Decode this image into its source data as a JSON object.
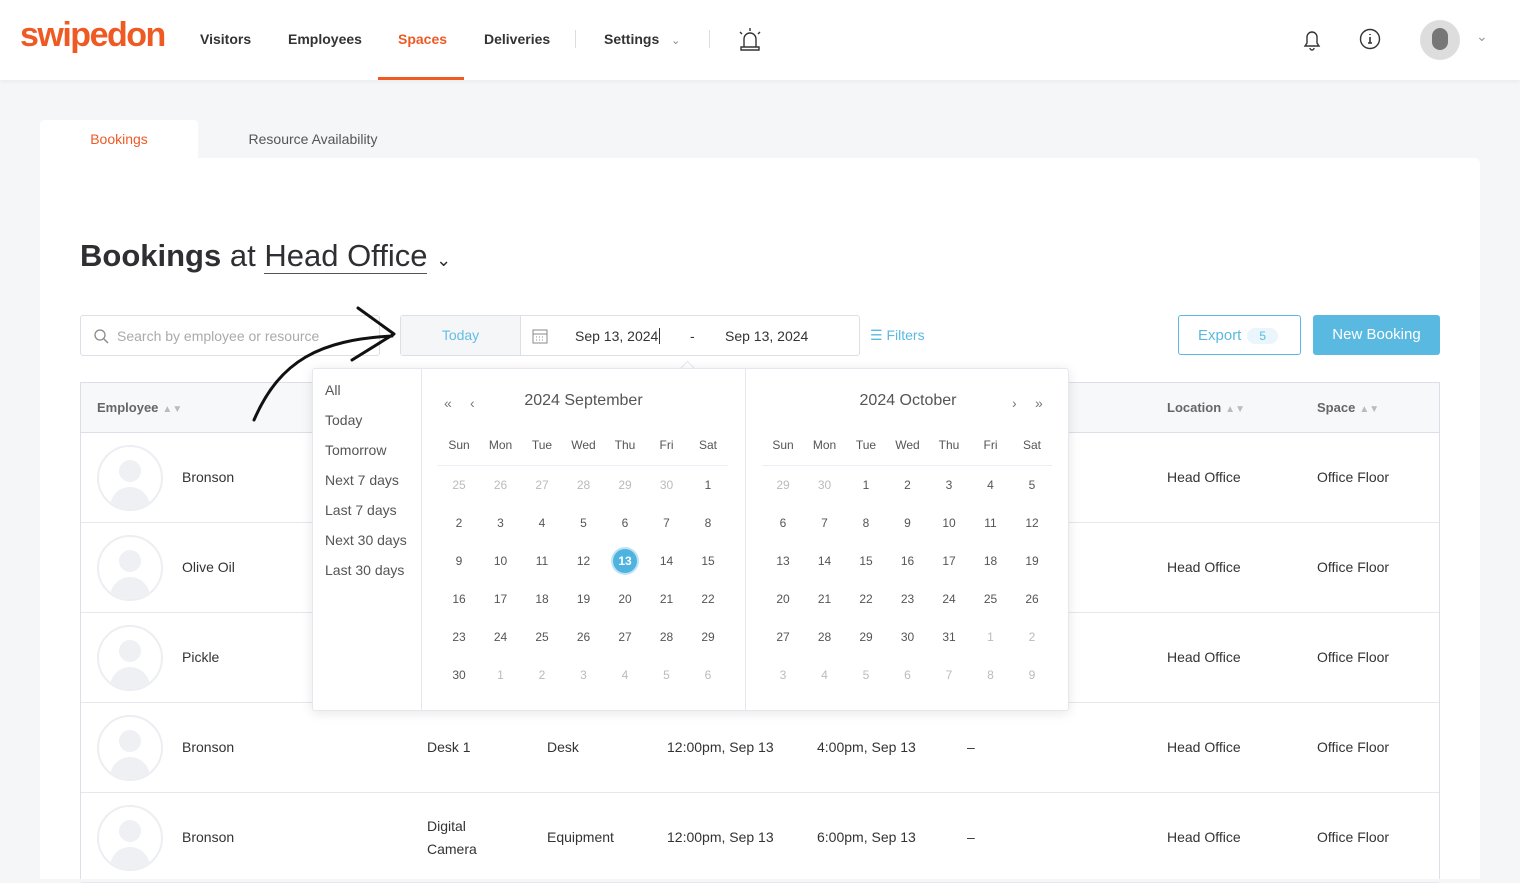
{
  "brand": {
    "logo": "swipedon",
    "accent": "#ef5a24",
    "primary": "#5ab9e0"
  },
  "nav": {
    "items": [
      "Visitors",
      "Employees",
      "Spaces",
      "Deliveries",
      "Settings"
    ],
    "active": "Spaces",
    "icons": [
      "alarm-light-icon",
      "bell-icon",
      "info-icon",
      "avatar",
      "chevron-down-icon"
    ]
  },
  "tabs": {
    "bookings": "Bookings",
    "availability": "Resource Availability"
  },
  "title": {
    "prefix": "Bookings",
    "at": "at",
    "location": "Head Office"
  },
  "toolbar": {
    "search_placeholder": "Search by employee or resource",
    "today": "Today",
    "start": "Sep 13, 2024",
    "sep": "-",
    "end": "Sep 13, 2024",
    "filters": "Filters",
    "export": "Export",
    "export_count": "5",
    "new_booking": "New Booking"
  },
  "table": {
    "headers": {
      "employee": "Employee",
      "location": "Location",
      "space": "Space"
    },
    "rows": [
      {
        "name": "Bronson",
        "resource": "",
        "type": "",
        "start": "",
        "end": "",
        "extra": "",
        "location": "Head Office",
        "space": "Office Floor"
      },
      {
        "name": "Olive Oil",
        "resource": "",
        "type": "",
        "start": "",
        "end": "",
        "extra": "",
        "location": "Head Office",
        "space": "Office Floor"
      },
      {
        "name": "Pickle",
        "resource": "",
        "type": "",
        "start": "",
        "end": "",
        "extra": "",
        "location": "Head Office",
        "space": "Office Floor"
      },
      {
        "name": "Bronson",
        "resource": "Desk 1",
        "type": "Desk",
        "start": "12:00pm, Sep 13",
        "end": "4:00pm, Sep 13",
        "extra": "–",
        "location": "Head Office",
        "space": "Office Floor"
      },
      {
        "name": "Bronson",
        "resource": "Digital Camera",
        "type": "Equipment",
        "start": "12:00pm, Sep 13",
        "end": "6:00pm, Sep 13",
        "extra": "–",
        "location": "Head Office",
        "space": "Office Floor"
      }
    ]
  },
  "picker": {
    "shortcuts": [
      "All",
      "Today",
      "Tomorrow",
      "Next 7 days",
      "Last 7 days",
      "Next 30 days",
      "Last 30 days"
    ],
    "weekdays": [
      "Sun",
      "Mon",
      "Tue",
      "Wed",
      "Thu",
      "Fri",
      "Sat"
    ],
    "left": {
      "title": "2024 September",
      "first": 25,
      "prevDays": 31,
      "days": 30,
      "lead": 6,
      "selected": 13
    },
    "right": {
      "title": "2024 October",
      "first": 29,
      "prevDays": 30,
      "days": 31,
      "lead": 2
    }
  }
}
